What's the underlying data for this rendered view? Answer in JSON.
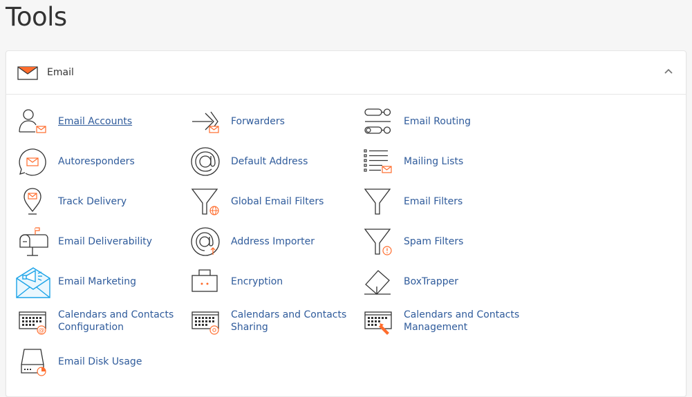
{
  "page": {
    "title": "Tools"
  },
  "panel": {
    "title": "Email",
    "collapse_icon": "chevron-up-icon"
  },
  "items": [
    {
      "label": "Email Accounts",
      "icon": "email-accounts-icon"
    },
    {
      "label": "Forwarders",
      "icon": "forwarders-icon"
    },
    {
      "label": "Email Routing",
      "icon": "email-routing-icon"
    },
    {
      "label": "Autoresponders",
      "icon": "autoresponders-icon"
    },
    {
      "label": "Default Address",
      "icon": "default-address-icon"
    },
    {
      "label": "Mailing Lists",
      "icon": "mailing-lists-icon"
    },
    {
      "label": "Track Delivery",
      "icon": "track-delivery-icon"
    },
    {
      "label": "Global Email Filters",
      "icon": "global-email-filters-icon"
    },
    {
      "label": "Email Filters",
      "icon": "email-filters-icon"
    },
    {
      "label": "Email Deliverability",
      "icon": "email-deliverability-icon"
    },
    {
      "label": "Address Importer",
      "icon": "address-importer-icon"
    },
    {
      "label": "Spam Filters",
      "icon": "spam-filters-icon"
    },
    {
      "label": "Email Marketing",
      "icon": "email-marketing-icon"
    },
    {
      "label": "Encryption",
      "icon": "encryption-icon"
    },
    {
      "label": "BoxTrapper",
      "icon": "boxtrapper-icon"
    },
    {
      "label": "Calendars and Contacts Configuration",
      "icon": "calendars-config-icon"
    },
    {
      "label": "Calendars and Contacts Sharing",
      "icon": "calendars-sharing-icon"
    },
    {
      "label": "Calendars and Contacts Management",
      "icon": "calendars-management-icon"
    },
    {
      "label": "Email Disk Usage",
      "icon": "email-disk-usage-icon"
    }
  ],
  "colors": {
    "accent": "#ff6c2c",
    "link": "#2f5b9b",
    "icon_stroke": "#333333",
    "marketing": "#1aa3e8"
  }
}
